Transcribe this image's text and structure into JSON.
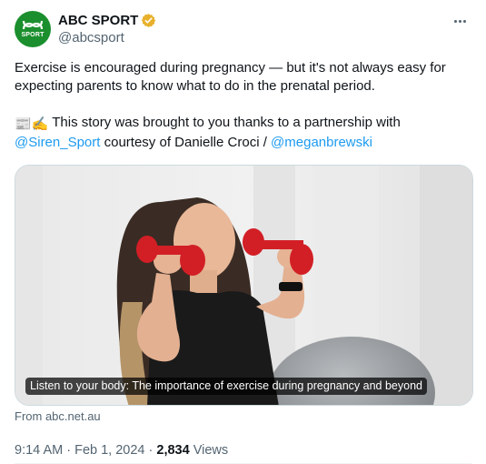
{
  "author": {
    "display_name": "ABC SPORT",
    "handle": "@abcsport",
    "avatar_text": "SPORT",
    "verified_color": "#e8b12c"
  },
  "tweet": {
    "line1": "Exercise is encouraged during pregnancy — but it's not always easy for expecting parents to know what to do in the prenatal period.",
    "emojis": "📰✍️",
    "line2_a": " This story was brought to you thanks to a partnership with",
    "mention1": "@Siren_Sport",
    "line2_b": " courtesy of Danielle Croci / ",
    "mention2": "@meganbrewski"
  },
  "card": {
    "caption": "Listen to your body: The importance of exercise during pregnancy and beyond",
    "source": "From abc.net.au"
  },
  "meta": {
    "time": "9:14 AM",
    "sep1": " · ",
    "date": "Feb 1, 2024",
    "sep2": " · ",
    "views_count": "2,834",
    "views_label": " Views"
  },
  "colors": {
    "link": "#1d9bf0",
    "brand_green": "#1b8f2d",
    "muted": "#536471"
  },
  "icons": [
    "abc-sport-logo-icon",
    "verified-badge-icon",
    "more-options-icon",
    "newspaper-emoji-icon",
    "writing-hand-emoji-icon"
  ]
}
